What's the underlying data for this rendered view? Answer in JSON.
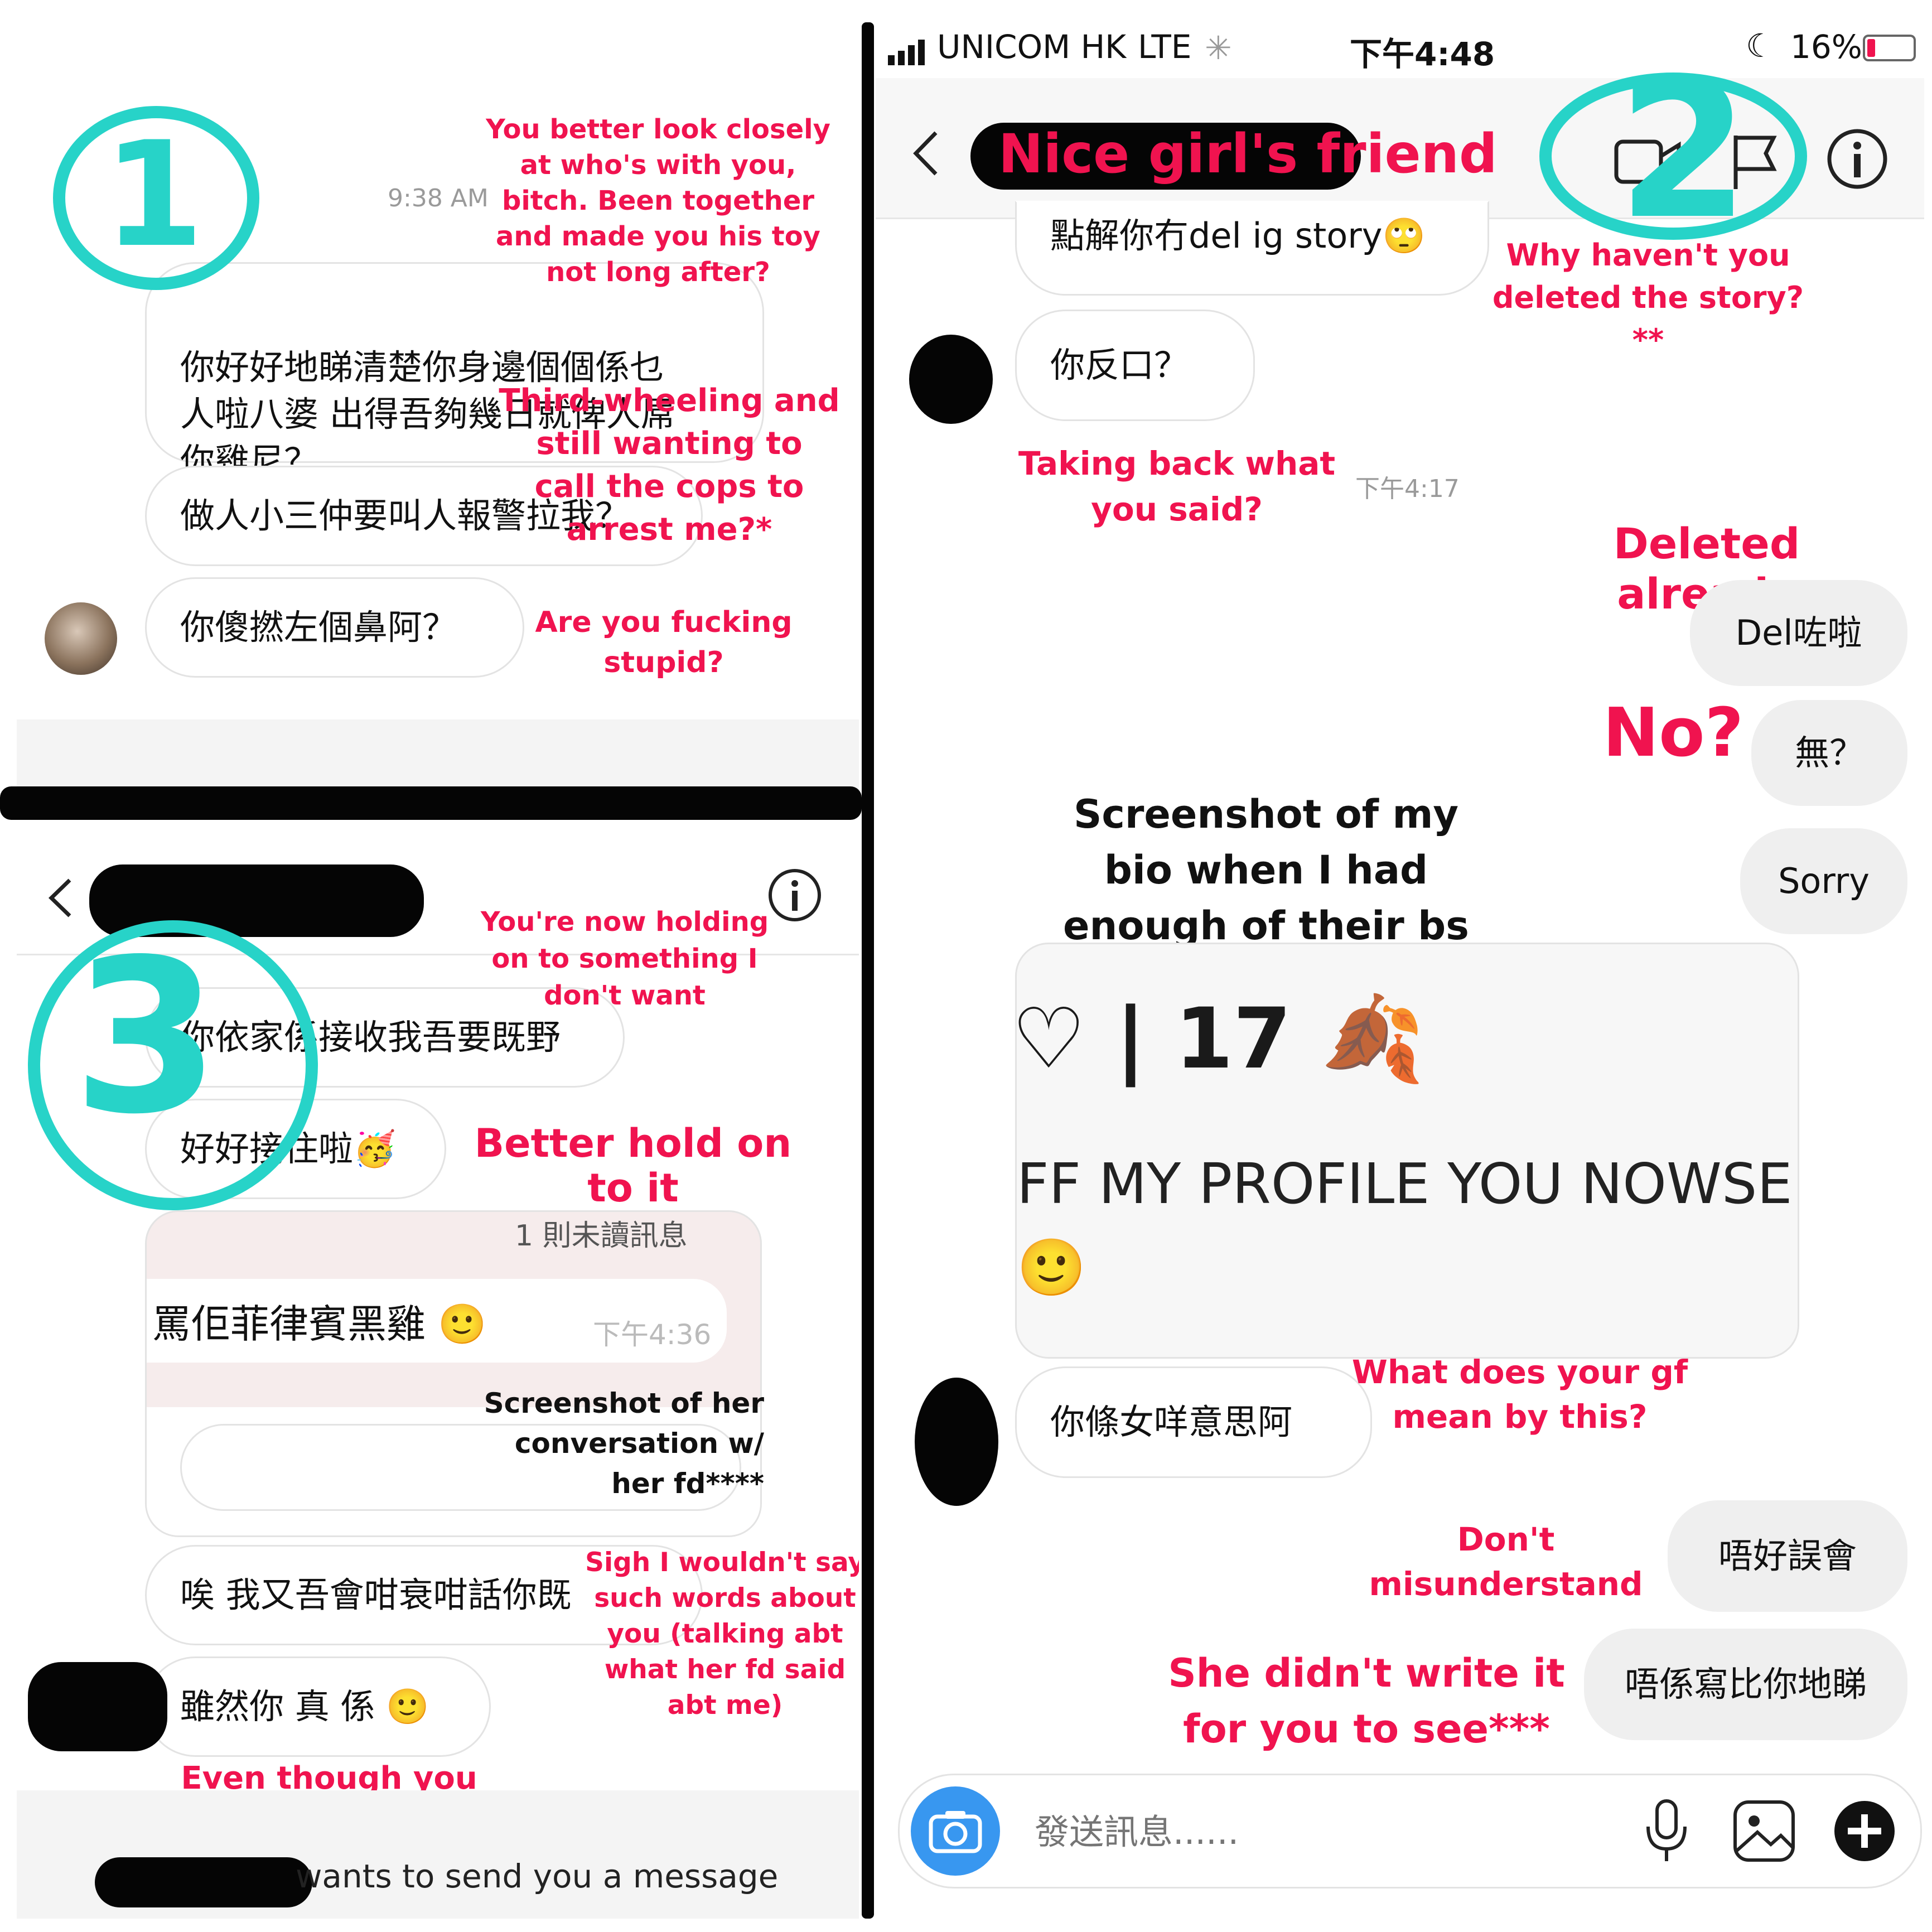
{
  "panel1": {
    "number": "1",
    "timestamp": "9:38 AM",
    "messages": [
      {
        "text": "你好好地睇清楚你身邊個個係乜\n人啦八婆 出得吾夠幾日就俾人屌\n你雞尼？"
      },
      {
        "text": "做人小三仲要叫人報警拉我？"
      },
      {
        "text": "你傻撚左個鼻阿？"
      }
    ],
    "annotations": [
      "You better look closely\nat who's with you,\nbitch. Been together\nand made you his toy\nnot long after?",
      "Third-wheeling and\nstill wanting to\ncall the cops to\narrest me?*",
      "Are you fucking\nstupid?"
    ]
  },
  "panel3": {
    "number": "3",
    "messages": [
      {
        "text": "你依家係接收我吾要既野"
      },
      {
        "text": "好好接住啦🥳"
      },
      {
        "text": "唉 我又吾會咁衰咁話你既"
      },
      {
        "text": "雖然你 真 係 🙂"
      }
    ],
    "embedded_screenshot": {
      "header": "1 則未讀訊息",
      "message": "罵佢菲律賓黑雞 🙂",
      "time": "下午4:36"
    },
    "annotations": [
      "You're now holding\non to something I\ndon't want",
      "Better hold on to it",
      "Screenshot of her\nconversation w/\nher fd****",
      "Sigh I wouldn't say\nsuch words about\nyou (talking abt\nwhat her fd said\nabt me)",
      "Even though you\nreally are one"
    ],
    "footer": "wants to send you a message"
  },
  "panel2": {
    "number": "2",
    "status_bar": {
      "carrier": "UNICOM HK",
      "network": "LTE",
      "time": "下午4:48",
      "battery": "16%"
    },
    "header": {
      "title": "Nice girl's friend",
      "back_icon": "chevron-left-icon",
      "video_icon": "video-call-icon",
      "flag_icon": "flag-icon",
      "info_icon": "info-icon"
    },
    "messages": [
      {
        "text": "點解你冇del ig story🙄",
        "side": "left"
      },
      {
        "text": "你反口？",
        "side": "left"
      },
      {
        "text": "Del咗啦",
        "side": "right"
      },
      {
        "text": "無？",
        "side": "right"
      },
      {
        "text": "Sorry",
        "side": "right"
      },
      {
        "text": "你條女咩意思阿",
        "side": "left"
      },
      {
        "text": "唔好誤會",
        "side": "right"
      },
      {
        "text": "唔係寫比你地睇",
        "side": "right"
      }
    ],
    "timestamp": "下午4:17",
    "bio_screenshot": {
      "line1": "♡ | 17 🍂",
      "line2": "FF MY PROFILE YOU NOWSE",
      "line3": "🙂"
    },
    "annotations": [
      "Why haven't you\ndeleted the story?\n**",
      "Taking back what\nyou said?",
      "Deleted already",
      "No?",
      "Screenshot of my\nbio when I had\nenough of their bs",
      "What does your gf\nmean by this?",
      "Don't\nmisunderstand",
      "She didn't write it\nfor you to see***"
    ],
    "composer": {
      "placeholder": "發送訊息......",
      "camera_icon": "camera-icon",
      "mic_icon": "microphone-icon",
      "image_icon": "gallery-icon",
      "plus_icon": "plus-icon"
    }
  },
  "colors": {
    "annotation_red": "#f0134f",
    "circle_teal": "#27d3c8",
    "camera_blue": "#3897f0",
    "bubble_border": "#e3e3e3",
    "bubble_grey": "#efefef"
  }
}
